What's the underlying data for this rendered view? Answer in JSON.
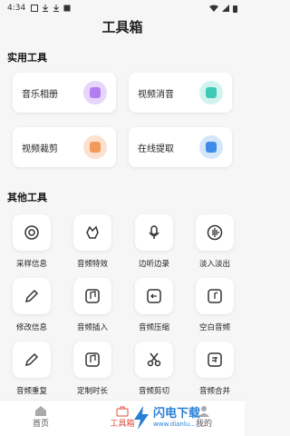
{
  "status": {
    "time": "4:34"
  },
  "header": {
    "title": "工具箱"
  },
  "sections": {
    "practical": "实用工具",
    "other": "其他工具"
  },
  "practical_tools": [
    {
      "label": "音乐相册",
      "color": "#e7d6fb",
      "accent": "#b37cf0",
      "icon": "music-album-icon"
    },
    {
      "label": "视频消音",
      "color": "#d1f3ee",
      "accent": "#3cc9b5",
      "icon": "mute-video-icon"
    },
    {
      "label": "视频裁剪",
      "color": "#fde1cf",
      "accent": "#f39a5a",
      "icon": "crop-video-icon"
    },
    {
      "label": "在线提取",
      "color": "#d6e6fb",
      "accent": "#3f8ce8",
      "icon": "extract-audio-icon"
    }
  ],
  "other_tools": [
    {
      "label": "采样信息",
      "icon": "sample-info-icon"
    },
    {
      "label": "音频特效",
      "icon": "audio-effect-icon"
    },
    {
      "label": "边听边录",
      "icon": "microphone-icon"
    },
    {
      "label": "淡入淡出",
      "icon": "fade-wave-icon"
    },
    {
      "label": "修改信息",
      "icon": "edit-pencil-icon"
    },
    {
      "label": "音频插入",
      "icon": "audio-insert-icon"
    },
    {
      "label": "音频压缩",
      "icon": "audio-compress-icon"
    },
    {
      "label": "空白音频",
      "icon": "blank-audio-icon"
    },
    {
      "label": "音频重复",
      "icon": "audio-repeat-icon"
    },
    {
      "label": "定制时长",
      "icon": "custom-duration-icon"
    },
    {
      "label": "音频剪切",
      "icon": "scissors-icon"
    },
    {
      "label": "音频合并",
      "icon": "audio-merge-icon"
    }
  ],
  "tabs": [
    {
      "label": "首页",
      "icon": "home-icon"
    },
    {
      "label": "工具箱",
      "icon": "toolbox-icon"
    },
    {
      "label": "我的",
      "icon": "profile-icon"
    }
  ],
  "watermark": {
    "brand": "闪电下载",
    "url": "www.dianlu..."
  }
}
